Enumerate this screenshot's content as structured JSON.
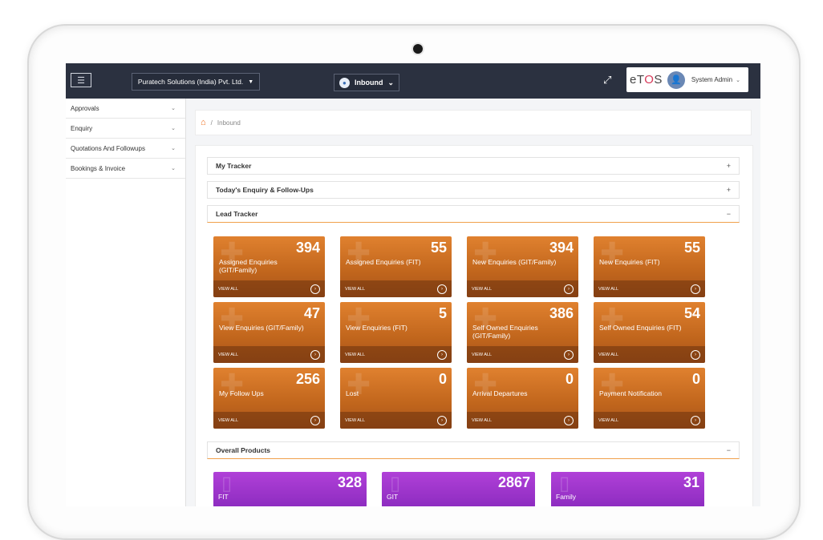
{
  "header": {
    "company": "Puratech Solutions (India) Pvt. Ltd.",
    "module": "Inbound",
    "brand_prefix": "eT",
    "brand_mid": "O",
    "brand_suffix": "S",
    "user": "System Admin"
  },
  "sidebar": {
    "items": [
      {
        "label": "Approvals"
      },
      {
        "label": "Enquiry"
      },
      {
        "label": "Quotations And Followups"
      },
      {
        "label": "Bookings & Invoice"
      }
    ]
  },
  "breadcrumb": {
    "sep": "/",
    "current": "Inbound"
  },
  "panels": {
    "my_tracker": {
      "title": "My Tracker",
      "toggle": "+"
    },
    "today": {
      "title": "Today's Enquiry & Follow-Ups",
      "toggle": "+"
    },
    "lead_tracker": {
      "title": "Lead Tracker",
      "toggle": "−"
    },
    "overall": {
      "title": "Overall Products",
      "toggle": "−"
    }
  },
  "lead_tiles": [
    {
      "count": "394",
      "label": "Assigned Enquiries (GIT/Family)",
      "footer": "VIEW ALL"
    },
    {
      "count": "55",
      "label": "Assigned Enquiries (FIT)",
      "footer": "VIEW ALL"
    },
    {
      "count": "394",
      "label": "New Enquiries (GIT/Family)",
      "footer": "VIEW ALL"
    },
    {
      "count": "55",
      "label": "New Enquiries (FIT)",
      "footer": "VIEW ALL"
    },
    {
      "count": "47",
      "label": "View Enquiries (GIT/Family)",
      "footer": "VIEW ALL"
    },
    {
      "count": "5",
      "label": "View Enquiries (FIT)",
      "footer": "VIEW ALL"
    },
    {
      "count": "386",
      "label": "Self Owned Enquiries (GIT/Family)",
      "footer": "VIEW ALL"
    },
    {
      "count": "54",
      "label": "Self Owned Enquiries (FIT)",
      "footer": "VIEW ALL"
    },
    {
      "count": "256",
      "label": "My Follow Ups",
      "footer": "VIEW ALL"
    },
    {
      "count": "0",
      "label": "Lost",
      "footer": "VIEW ALL"
    },
    {
      "count": "0",
      "label": "Arrival Departures",
      "footer": "VIEW ALL"
    },
    {
      "count": "0",
      "label": "Payment Notification",
      "footer": "VIEW ALL"
    }
  ],
  "products": [
    {
      "count": "328",
      "label": "FIT"
    },
    {
      "count": "2867",
      "label": "GIT"
    },
    {
      "count": "31",
      "label": "Family"
    }
  ]
}
